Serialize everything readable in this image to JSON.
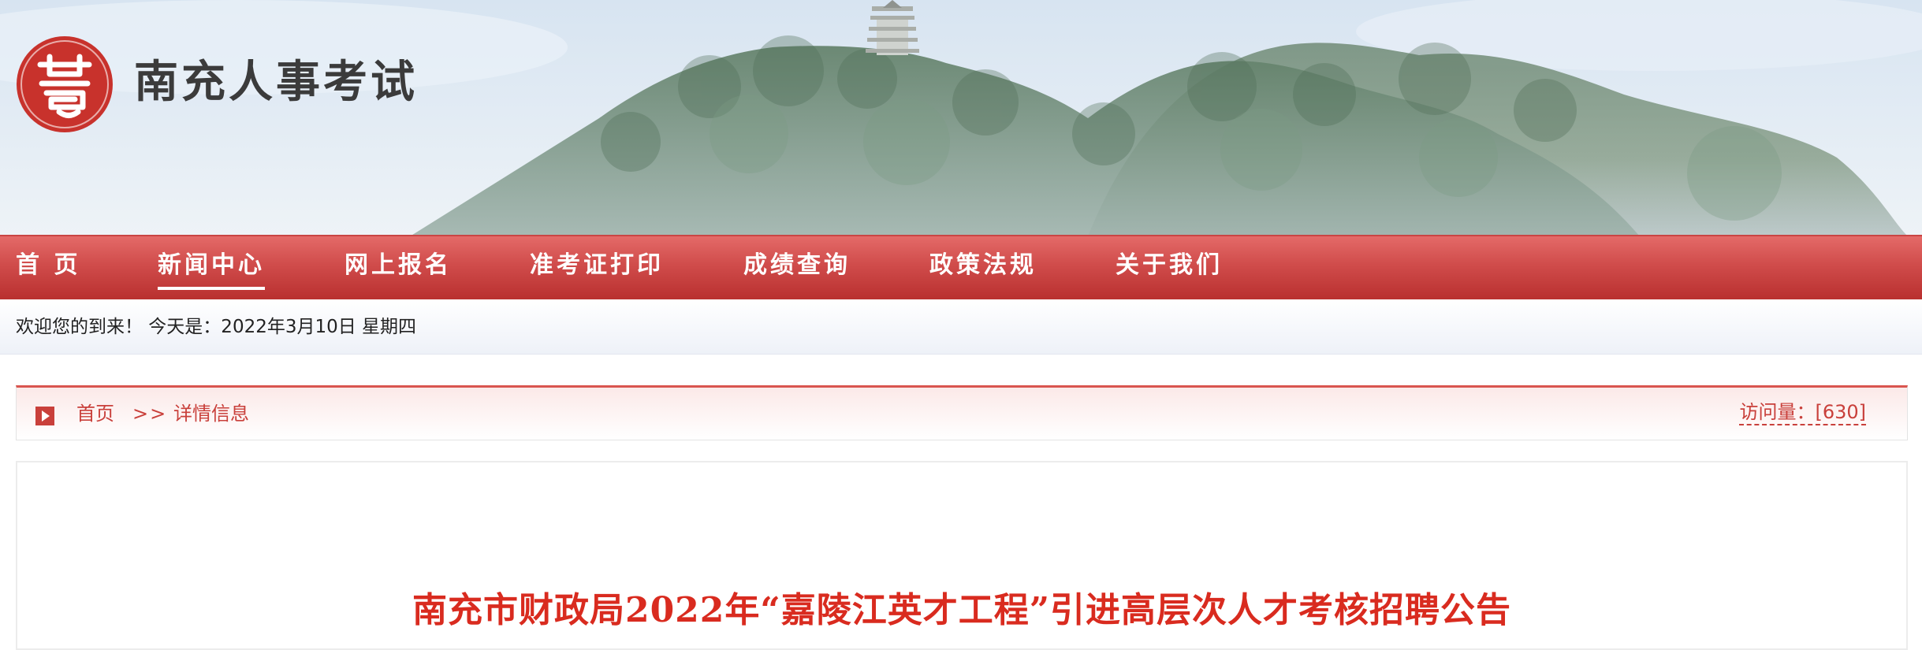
{
  "header": {
    "site_title": "南充人事考试",
    "logo_icon": "seal-logo-icon"
  },
  "nav": {
    "items": [
      {
        "label": "首 页",
        "active": false
      },
      {
        "label": "新闻中心",
        "active": true
      },
      {
        "label": "网上报名",
        "active": false
      },
      {
        "label": "准考证打印",
        "active": false
      },
      {
        "label": "成绩查询",
        "active": false
      },
      {
        "label": "政策法规",
        "active": false
      },
      {
        "label": "关于我们",
        "active": false
      }
    ]
  },
  "welcome": {
    "text": "欢迎您的到来！  今天是：2022年3月10日 星期四"
  },
  "breadcrumb": {
    "home": "首页",
    "separator": ">>",
    "current": "详情信息",
    "visits": "访问量：[630]"
  },
  "article": {
    "title": "南充市财政局2022年“嘉陵江英才工程”引进高层次人才考核招聘公告"
  },
  "colors": {
    "nav_red": "#d04c4b",
    "accent_red": "#c9403b",
    "title_red": "#d92b1f"
  }
}
